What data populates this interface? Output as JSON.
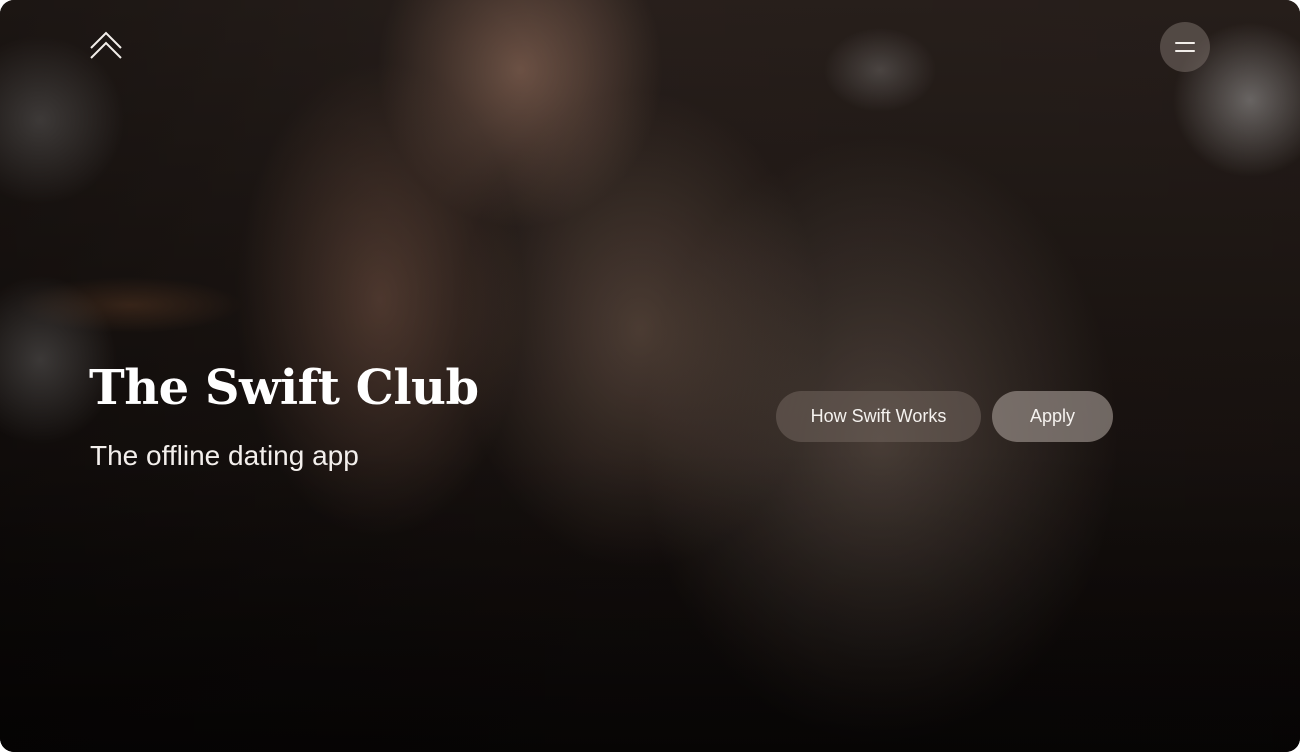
{
  "header": {
    "logo_icon": "double-chevron-up-icon",
    "menu_icon": "hamburger-menu-icon"
  },
  "hero": {
    "title": "The Swift Club",
    "subtitle": "The offline dating app",
    "background": "dimmed photo of a blonde woman wearing a chain necklace at a bar"
  },
  "actions": {
    "how_it_works_label": "How Swift Works",
    "apply_label": "Apply"
  },
  "colors": {
    "text": "#ffffff",
    "button_secondary": "#6e625c",
    "button_primary": "#968c86"
  }
}
